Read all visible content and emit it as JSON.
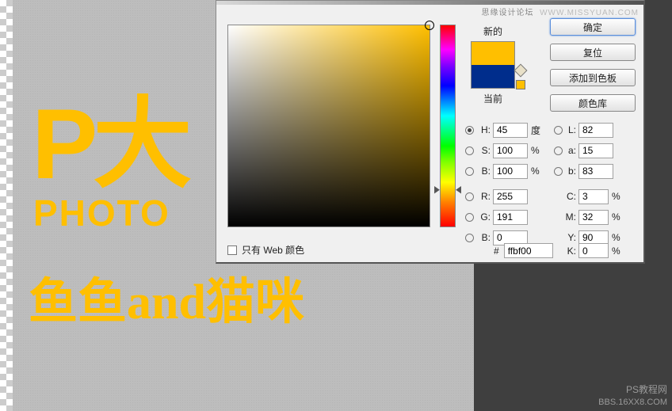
{
  "watermark_top": {
    "label": "思缘设计论坛",
    "url": "WWW.MISSYUAN.COM"
  },
  "watermark_bottom": {
    "line1": "PS教程网",
    "line2": "BBS.16XX8.COM"
  },
  "canvas": {
    "text1": "P大",
    "text2": "PHOTO",
    "text3": "鱼鱼and猫咪"
  },
  "picker": {
    "new_label": "新的",
    "current_label": "当前",
    "buttons": {
      "ok": "确定",
      "reset": "复位",
      "add_swatch": "添加到色板",
      "libraries": "颜色库"
    },
    "hsb": {
      "H": {
        "label": "H:",
        "value": "45",
        "unit": "度"
      },
      "S": {
        "label": "S:",
        "value": "100",
        "unit": "%"
      },
      "B": {
        "label": "B:",
        "value": "100",
        "unit": "%"
      }
    },
    "rgb": {
      "R": {
        "label": "R:",
        "value": "255"
      },
      "G": {
        "label": "G:",
        "value": "191"
      },
      "B": {
        "label": "B:",
        "value": "0"
      }
    },
    "lab": {
      "L": {
        "label": "L:",
        "value": "82"
      },
      "a": {
        "label": "a:",
        "value": "15"
      },
      "b": {
        "label": "b:",
        "value": "83"
      }
    },
    "cmyk": {
      "C": {
        "label": "C:",
        "value": "3",
        "unit": "%"
      },
      "M": {
        "label": "M:",
        "value": "32",
        "unit": "%"
      },
      "Y": {
        "label": "Y:",
        "value": "90",
        "unit": "%"
      },
      "K": {
        "label": "K:",
        "value": "0",
        "unit": "%"
      }
    },
    "hex_prefix": "#",
    "hex": "ffbf00",
    "web_only_label": "只有 Web 颜色",
    "new_color": "#ffbf00",
    "current_color": "#002d8c"
  }
}
